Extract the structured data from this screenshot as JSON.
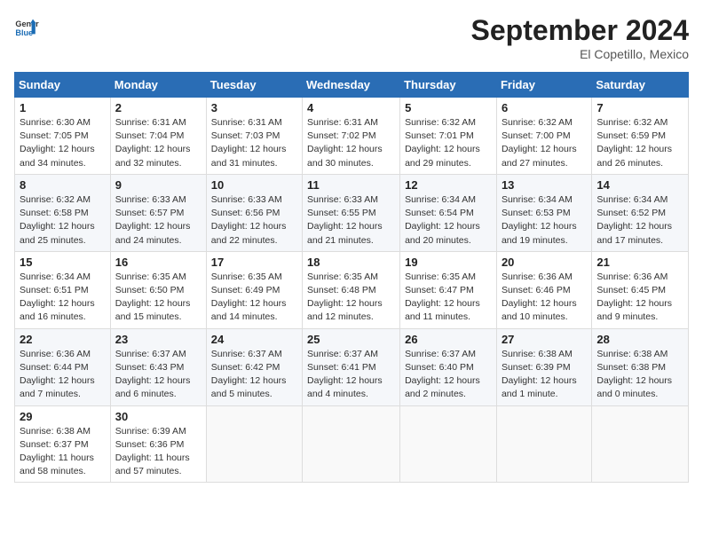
{
  "logo": {
    "line1": "General",
    "line2": "Blue"
  },
  "title": "September 2024",
  "location": "El Copetillo, Mexico",
  "days_of_week": [
    "Sunday",
    "Monday",
    "Tuesday",
    "Wednesday",
    "Thursday",
    "Friday",
    "Saturday"
  ],
  "weeks": [
    [
      {
        "day": "1",
        "info": "Sunrise: 6:30 AM\nSunset: 7:05 PM\nDaylight: 12 hours\nand 34 minutes."
      },
      {
        "day": "2",
        "info": "Sunrise: 6:31 AM\nSunset: 7:04 PM\nDaylight: 12 hours\nand 32 minutes."
      },
      {
        "day": "3",
        "info": "Sunrise: 6:31 AM\nSunset: 7:03 PM\nDaylight: 12 hours\nand 31 minutes."
      },
      {
        "day": "4",
        "info": "Sunrise: 6:31 AM\nSunset: 7:02 PM\nDaylight: 12 hours\nand 30 minutes."
      },
      {
        "day": "5",
        "info": "Sunrise: 6:32 AM\nSunset: 7:01 PM\nDaylight: 12 hours\nand 29 minutes."
      },
      {
        "day": "6",
        "info": "Sunrise: 6:32 AM\nSunset: 7:00 PM\nDaylight: 12 hours\nand 27 minutes."
      },
      {
        "day": "7",
        "info": "Sunrise: 6:32 AM\nSunset: 6:59 PM\nDaylight: 12 hours\nand 26 minutes."
      }
    ],
    [
      {
        "day": "8",
        "info": "Sunrise: 6:32 AM\nSunset: 6:58 PM\nDaylight: 12 hours\nand 25 minutes."
      },
      {
        "day": "9",
        "info": "Sunrise: 6:33 AM\nSunset: 6:57 PM\nDaylight: 12 hours\nand 24 minutes."
      },
      {
        "day": "10",
        "info": "Sunrise: 6:33 AM\nSunset: 6:56 PM\nDaylight: 12 hours\nand 22 minutes."
      },
      {
        "day": "11",
        "info": "Sunrise: 6:33 AM\nSunset: 6:55 PM\nDaylight: 12 hours\nand 21 minutes."
      },
      {
        "day": "12",
        "info": "Sunrise: 6:34 AM\nSunset: 6:54 PM\nDaylight: 12 hours\nand 20 minutes."
      },
      {
        "day": "13",
        "info": "Sunrise: 6:34 AM\nSunset: 6:53 PM\nDaylight: 12 hours\nand 19 minutes."
      },
      {
        "day": "14",
        "info": "Sunrise: 6:34 AM\nSunset: 6:52 PM\nDaylight: 12 hours\nand 17 minutes."
      }
    ],
    [
      {
        "day": "15",
        "info": "Sunrise: 6:34 AM\nSunset: 6:51 PM\nDaylight: 12 hours\nand 16 minutes."
      },
      {
        "day": "16",
        "info": "Sunrise: 6:35 AM\nSunset: 6:50 PM\nDaylight: 12 hours\nand 15 minutes."
      },
      {
        "day": "17",
        "info": "Sunrise: 6:35 AM\nSunset: 6:49 PM\nDaylight: 12 hours\nand 14 minutes."
      },
      {
        "day": "18",
        "info": "Sunrise: 6:35 AM\nSunset: 6:48 PM\nDaylight: 12 hours\nand 12 minutes."
      },
      {
        "day": "19",
        "info": "Sunrise: 6:35 AM\nSunset: 6:47 PM\nDaylight: 12 hours\nand 11 minutes."
      },
      {
        "day": "20",
        "info": "Sunrise: 6:36 AM\nSunset: 6:46 PM\nDaylight: 12 hours\nand 10 minutes."
      },
      {
        "day": "21",
        "info": "Sunrise: 6:36 AM\nSunset: 6:45 PM\nDaylight: 12 hours\nand 9 minutes."
      }
    ],
    [
      {
        "day": "22",
        "info": "Sunrise: 6:36 AM\nSunset: 6:44 PM\nDaylight: 12 hours\nand 7 minutes."
      },
      {
        "day": "23",
        "info": "Sunrise: 6:37 AM\nSunset: 6:43 PM\nDaylight: 12 hours\nand 6 minutes."
      },
      {
        "day": "24",
        "info": "Sunrise: 6:37 AM\nSunset: 6:42 PM\nDaylight: 12 hours\nand 5 minutes."
      },
      {
        "day": "25",
        "info": "Sunrise: 6:37 AM\nSunset: 6:41 PM\nDaylight: 12 hours\nand 4 minutes."
      },
      {
        "day": "26",
        "info": "Sunrise: 6:37 AM\nSunset: 6:40 PM\nDaylight: 12 hours\nand 2 minutes."
      },
      {
        "day": "27",
        "info": "Sunrise: 6:38 AM\nSunset: 6:39 PM\nDaylight: 12 hours\nand 1 minute."
      },
      {
        "day": "28",
        "info": "Sunrise: 6:38 AM\nSunset: 6:38 PM\nDaylight: 12 hours\nand 0 minutes."
      }
    ],
    [
      {
        "day": "29",
        "info": "Sunrise: 6:38 AM\nSunset: 6:37 PM\nDaylight: 11 hours\nand 58 minutes."
      },
      {
        "day": "30",
        "info": "Sunrise: 6:39 AM\nSunset: 6:36 PM\nDaylight: 11 hours\nand 57 minutes."
      },
      {
        "day": "",
        "info": ""
      },
      {
        "day": "",
        "info": ""
      },
      {
        "day": "",
        "info": ""
      },
      {
        "day": "",
        "info": ""
      },
      {
        "day": "",
        "info": ""
      }
    ]
  ]
}
